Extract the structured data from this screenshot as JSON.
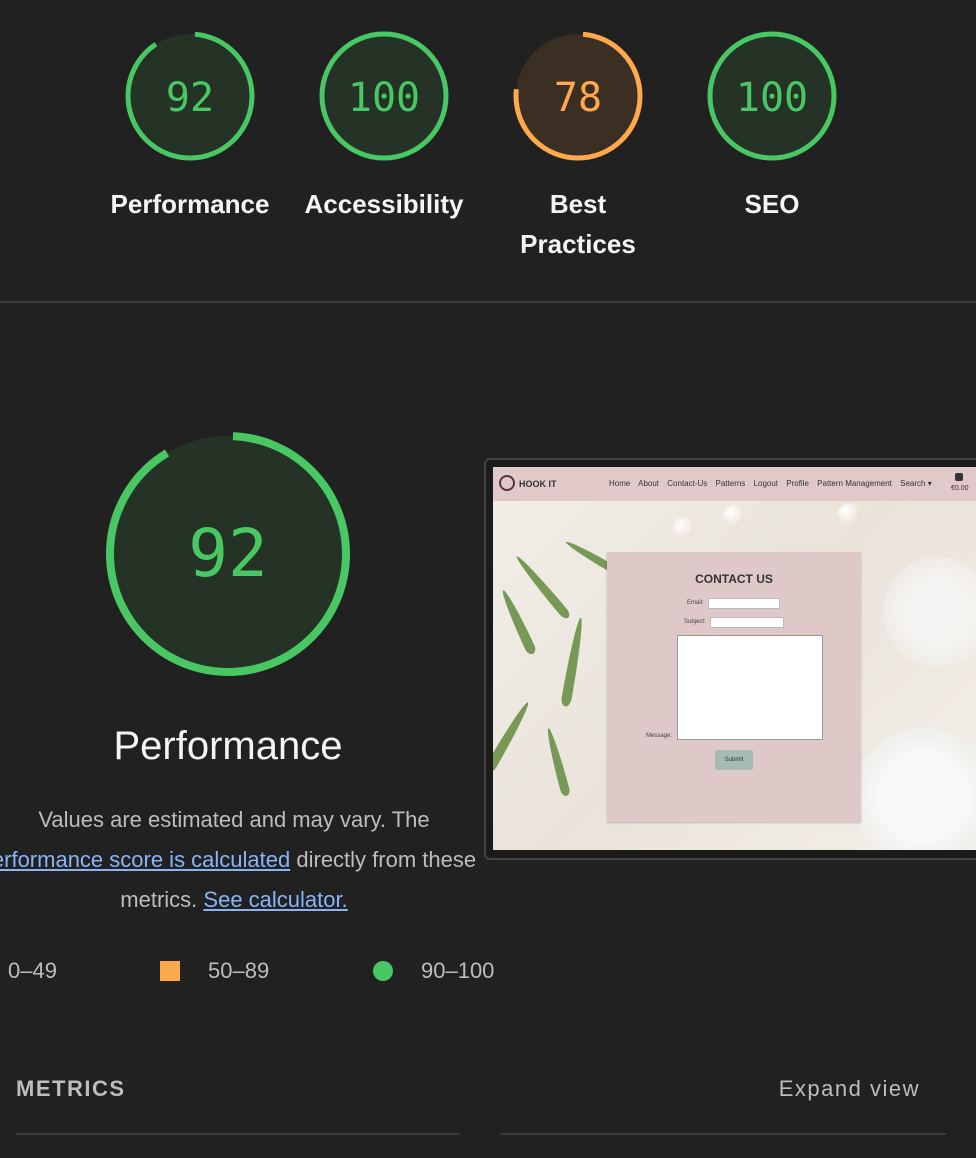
{
  "categories": [
    {
      "name": "Performance",
      "score": "92",
      "score_value": 92,
      "color": "#48c763",
      "bg": "#243326"
    },
    {
      "name": "Accessibility",
      "score": "100",
      "score_value": 100,
      "color": "#48c763",
      "bg": "#243326"
    },
    {
      "name": "Best Practices",
      "score": "78",
      "score_value": 78,
      "color": "#ffa94d",
      "bg": "#3a2f22"
    },
    {
      "name": "SEO",
      "score": "100",
      "score_value": 100,
      "color": "#48c763",
      "bg": "#243326"
    }
  ],
  "main": {
    "score": "92",
    "score_value": 92,
    "title": "Performance",
    "desc_part1": "Values are estimated and may vary. The",
    "desc_link1": "erformance score is calculated",
    "desc_part2": "directly from these metrics.",
    "desc_link2": "See calculator."
  },
  "legend": [
    {
      "range": "0–49",
      "shape": "triangle"
    },
    {
      "range": "50–89",
      "shape": "square",
      "color": "#ffa94d"
    },
    {
      "range": "90–100",
      "shape": "circle",
      "color": "#48c763"
    }
  ],
  "screenshot": {
    "logo": "HOOK IT",
    "nav": [
      "Home",
      "About",
      "Contact-Us",
      "Patterns",
      "Logout",
      "Profile",
      "Pattern Management",
      "Search ▾"
    ],
    "cart": "€0.00",
    "form_title": "CONTACT US",
    "email_label": "Email:",
    "subject_label": "Subject:",
    "message_label": "Message:",
    "submit_label": "Submit"
  },
  "metrics": {
    "title": "METRICS",
    "expand_label": "Expand view"
  }
}
